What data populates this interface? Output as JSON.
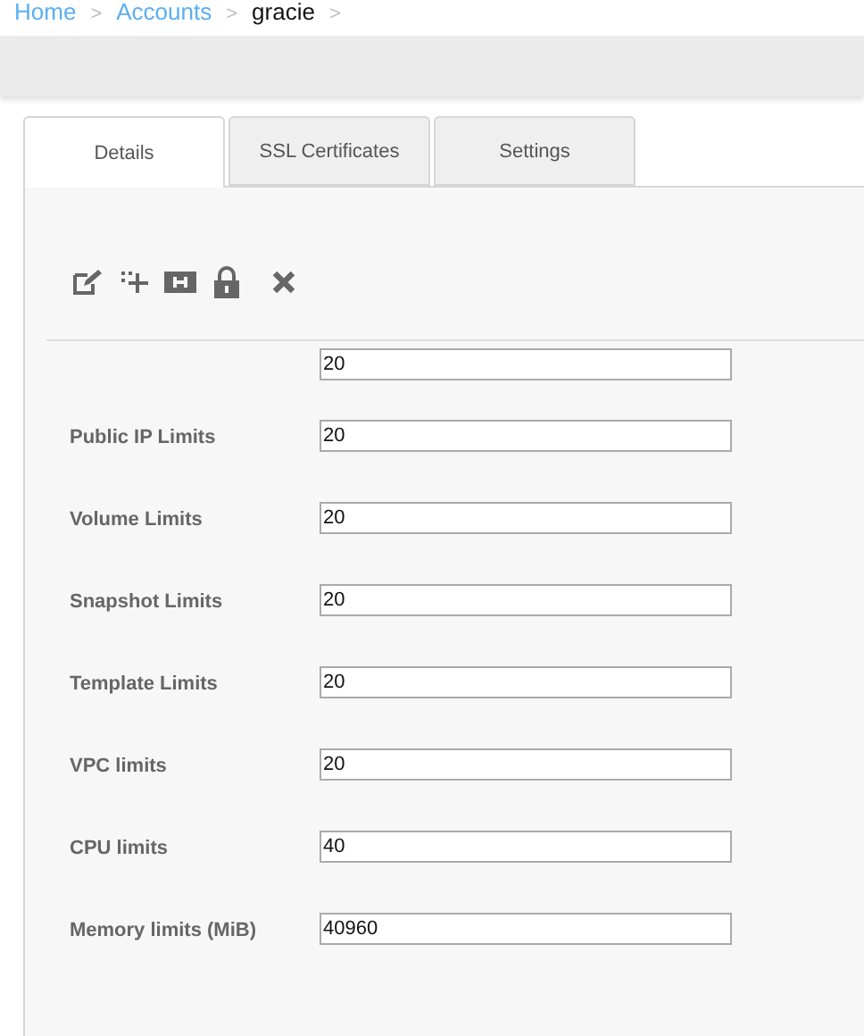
{
  "breadcrumb": [
    {
      "label": "Home",
      "kind": "link",
      "separator": ">"
    },
    {
      "label": "Accounts",
      "kind": "link",
      "separator": ">"
    },
    {
      "label": "gracie",
      "kind": "current",
      "separator": ">"
    }
  ],
  "tabs": [
    {
      "label": "Details",
      "selected": true
    },
    {
      "label": "SSL Certificates",
      "selected": false
    },
    {
      "label": "Settings",
      "selected": false
    }
  ],
  "toolbar": [
    {
      "kind": "edit"
    },
    {
      "kind": "add"
    },
    {
      "kind": "split"
    },
    {
      "kind": "lock"
    },
    {
      "kind": "delete"
    }
  ],
  "partial_field": {
    "value": "20"
  },
  "fields": [
    {
      "label": "Public IP Limits",
      "value": "20"
    },
    {
      "label": "Volume Limits",
      "value": "20"
    },
    {
      "label": "Snapshot Limits",
      "value": "20"
    },
    {
      "label": "Template Limits",
      "value": "20"
    },
    {
      "label": "VPC limits",
      "value": "20"
    },
    {
      "label": "CPU limits",
      "value": "40"
    },
    {
      "label": "Memory limits (MiB)",
      "value": "40960"
    }
  ]
}
